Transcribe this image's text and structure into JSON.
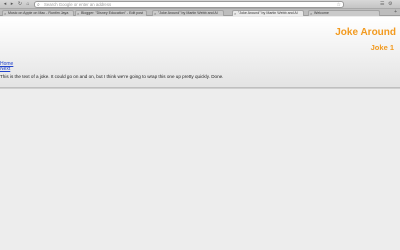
{
  "toolbar": {
    "back_icon": "back-arrow-icon",
    "forward_icon": "forward-arrow-icon",
    "reload_icon": "reload-icon",
    "home_icon": "home-icon",
    "address_placeholder": "Search Google or enter an address",
    "star_icon": "star-icon"
  },
  "tabs": [
    {
      "label": "Music on Apple on Mac - Runtim Jaya",
      "active": false
    },
    {
      "label": "Blogger: \"Disney Education\" - Edit post",
      "active": false
    },
    {
      "label": "\"Joke Around\" by Martin Webb and Al",
      "active": false
    },
    {
      "label": "\"Joke Around\" by Martin Webb and Al",
      "active": true
    },
    {
      "label": "Welcome",
      "active": false
    }
  ],
  "page": {
    "site_title": "Joke Around",
    "joke_title": "Joke 1",
    "nav": {
      "home": "Home",
      "next": "Next"
    },
    "joke_text": "This is the text of a joke. It could go on and on, but I think we're going to wrap this one up pretty quickly. Done."
  }
}
